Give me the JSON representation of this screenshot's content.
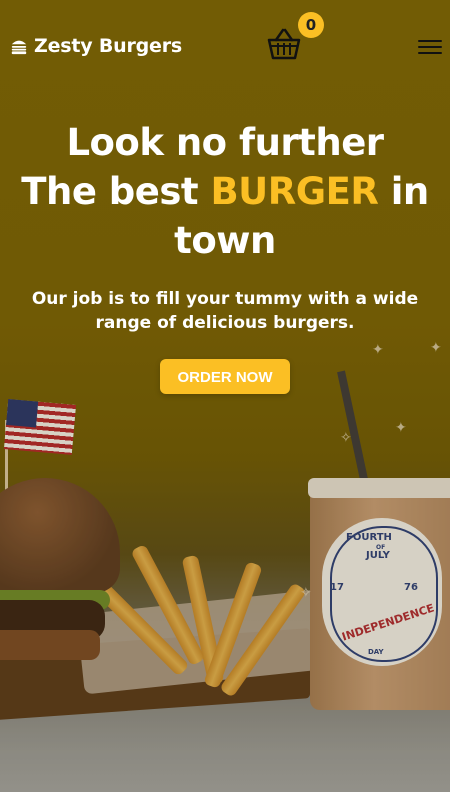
{
  "brand": {
    "name": "Zesty Burgers",
    "icon": "burger-icon"
  },
  "cart": {
    "icon": "basket-icon",
    "count": "0"
  },
  "menu": {
    "icon": "hamburger-menu-icon"
  },
  "hero": {
    "line1": "Look no further",
    "line2_pre": "The best ",
    "line2_highlight": "BURGER",
    "line2_post": " in",
    "line3": "town",
    "subtitle": "Our job is to fill your tummy with a wide range of delicious burgers.",
    "cta": "ORDER NOW"
  },
  "photo": {
    "cup_label": {
      "top": "FOURTH",
      "of": "OF",
      "month": "JULY",
      "year_left": "17",
      "year_right": "76",
      "arc": "INDEPENDENCE",
      "day": "DAY"
    }
  },
  "colors": {
    "accent": "#fbbf24",
    "overlay": "#7a6105"
  }
}
